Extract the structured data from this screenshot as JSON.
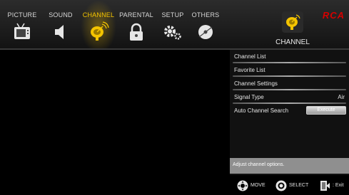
{
  "brand": "RCA",
  "tabs": [
    {
      "label": "PICTURE",
      "icon": "tv-icon"
    },
    {
      "label": "SOUND",
      "icon": "speaker-icon"
    },
    {
      "label": "CHANNEL",
      "icon": "satellite-dish-icon",
      "active": true
    },
    {
      "label": "PARENTAL",
      "icon": "lock-icon"
    },
    {
      "label": "SETUP",
      "icon": "gears-icon"
    },
    {
      "label": "OTHERS",
      "icon": "disc-icon"
    }
  ],
  "badge": {
    "label": "CHANNEL",
    "icon": "satellite-dish-icon"
  },
  "menu": {
    "items": [
      {
        "label": "Channel List"
      },
      {
        "label": "Favorite List"
      },
      {
        "label": "Channel Settings"
      },
      {
        "label": "Signal Type",
        "value": "Air"
      },
      {
        "label": "Auto Channel Search",
        "button": "Execute"
      }
    ]
  },
  "help": "Adjust channel options.",
  "footer": {
    "move": "MOVE",
    "select": "SELECT",
    "exit": ": Exit"
  },
  "colors": {
    "accent": "#f4c400",
    "brand": "#d50000",
    "panel": "#111111",
    "help_bg": "#8f8f8f"
  }
}
